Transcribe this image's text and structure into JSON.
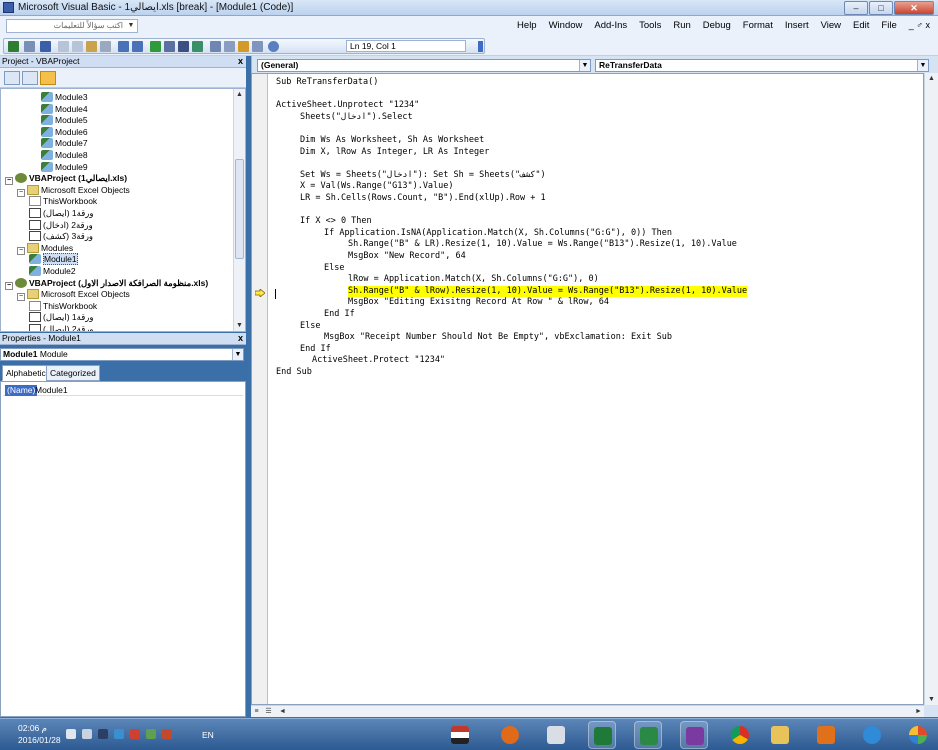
{
  "window": {
    "title": "Microsoft Visual Basic - 1ايصالي.xls [break] - [Module1 (Code)]",
    "controls": {
      "minimize": "–",
      "maximize": "□",
      "close": "✕"
    }
  },
  "menubar": {
    "ask_placeholder": "اكتب سؤالاً للتعليمات",
    "items": [
      "Help",
      "Window",
      "Add-Ins",
      "Tools",
      "Run",
      "Debug",
      "Format",
      "Insert",
      "View",
      "Edit",
      "File"
    ],
    "mdi_controls": "_ ♂ x"
  },
  "toolbar": {
    "position_readout": "Ln 19, Col 1",
    "icons": [
      "excel-icon",
      "insert-icon",
      "save-icon",
      "cut-icon",
      "copy-icon",
      "paste-icon",
      "find-icon",
      "undo-icon",
      "redo-icon",
      "run-icon",
      "break-icon",
      "reset-icon",
      "design-mode-icon",
      "project-explorer-icon",
      "properties-icon",
      "object-browser-icon",
      "toolbox-icon",
      "help-icon"
    ]
  },
  "project_pane": {
    "title": "Project - VBAProject",
    "close": "x",
    "tree": [
      {
        "label": "Module3",
        "icon": "module-icon",
        "indent": 3
      },
      {
        "label": "Module4",
        "icon": "module-icon",
        "indent": 3
      },
      {
        "label": "Module5",
        "icon": "module-icon",
        "indent": 3
      },
      {
        "label": "Module6",
        "icon": "module-icon",
        "indent": 3
      },
      {
        "label": "Module7",
        "icon": "module-icon",
        "indent": 3
      },
      {
        "label": "Module8",
        "icon": "module-icon",
        "indent": 3
      },
      {
        "label": "Module9",
        "icon": "module-icon",
        "indent": 3
      },
      {
        "label": "VBAProject (1ايصالي.xls)",
        "icon": "project-icon",
        "indent": 0,
        "bold": true,
        "expander": "−"
      },
      {
        "label": "Microsoft Excel Objects",
        "icon": "folder-icon",
        "indent": 1,
        "expander": "−"
      },
      {
        "label": "ThisWorkbook",
        "icon": "workbook-icon",
        "indent": 2
      },
      {
        "label": "(ورقة1 (ايصال",
        "icon": "sheet-icon",
        "indent": 2
      },
      {
        "label": "(ورقة2 (ادخال",
        "icon": "sheet-icon",
        "indent": 2
      },
      {
        "label": "(ورقة3 (كشف",
        "icon": "sheet-icon",
        "indent": 2
      },
      {
        "label": "Modules",
        "icon": "folder-icon",
        "indent": 1,
        "expander": "−"
      },
      {
        "label": "Module1",
        "icon": "module-icon",
        "indent": 2,
        "selected": true
      },
      {
        "label": "Module2",
        "icon": "module-icon",
        "indent": 2
      },
      {
        "label": "VBAProject (منظومة الصرافكة الاصدار الاول.xls)",
        "icon": "project-icon",
        "indent": 0,
        "bold": true,
        "expander": "−"
      },
      {
        "label": "Microsoft Excel Objects",
        "icon": "folder-icon",
        "indent": 1,
        "expander": "−"
      },
      {
        "label": "ThisWorkbook",
        "icon": "workbook-icon",
        "indent": 2
      },
      {
        "label": "(ورقة1 (ايصال",
        "icon": "sheet-icon",
        "indent": 2
      },
      {
        "label": "(ورقة2 (ايصال",
        "icon": "sheet-icon",
        "indent": 2
      }
    ]
  },
  "properties_pane": {
    "title": "Properties - Module1",
    "close": "x",
    "object_name": "Module1",
    "object_type": "Module",
    "tabs": [
      "Alphabetic",
      "Categorized"
    ],
    "rows": [
      {
        "name": "(Name)",
        "value": "Module1"
      }
    ]
  },
  "code_window": {
    "object_combo": "(General)",
    "proc_combo": "ReTransferData",
    "lines": [
      {
        "text": "Sub ReTransferData()",
        "indent": 0
      },
      {
        "text": "",
        "indent": 0
      },
      {
        "text": "ActiveSheet.Unprotect \"1234\"",
        "indent": 0
      },
      {
        "text": "Sheets(\"ادخال\").Select",
        "indent": 2
      },
      {
        "text": "",
        "indent": 0
      },
      {
        "text": "Dim Ws As Worksheet, Sh As Worksheet",
        "indent": 2
      },
      {
        "text": "Dim X, lRow As Integer, LR As Integer",
        "indent": 2
      },
      {
        "text": "",
        "indent": 0
      },
      {
        "text": "Set Ws = Sheets(\"ادخال\"): Set Sh = Sheets(\"كشف\")",
        "indent": 2
      },
      {
        "text": "X = Val(Ws.Range(\"G13\").Value)",
        "indent": 2
      },
      {
        "text": "LR = Sh.Cells(Rows.Count, \"B\").End(xlUp).Row + 1",
        "indent": 2
      },
      {
        "text": "",
        "indent": 0
      },
      {
        "text": "If X <> 0 Then",
        "indent": 2
      },
      {
        "text": "If Application.IsNA(Application.Match(X, Sh.Columns(\"G:G\"), 0)) Then",
        "indent": 4
      },
      {
        "text": "Sh.Range(\"B\" & LR).Resize(1, 10).Value = Ws.Range(\"B13\").Resize(1, 10).Value",
        "indent": 6
      },
      {
        "text": "MsgBox \"New Record\", 64",
        "indent": 6
      },
      {
        "text": "Else",
        "indent": 4
      },
      {
        "text": "lRow = Application.Match(X, Sh.Columns(\"G:G\"), 0)",
        "indent": 6
      },
      {
        "text": "Sh.Range(\"B\" & lRow).Resize(1, 10).Value = Ws.Range(\"B13\").Resize(1, 10).Value",
        "indent": 6,
        "highlight": true
      },
      {
        "text": "MsgBox \"Editing Exisitng Record At Row \" & lRow, 64",
        "indent": 6
      },
      {
        "text": "End If",
        "indent": 4
      },
      {
        "text": "Else",
        "indent": 2
      },
      {
        "text": "MsgBox \"Receipt Number Should Not Be Empty\", vbExclamation: Exit Sub",
        "indent": 4
      },
      {
        "text": "End If",
        "indent": 2
      },
      {
        "text": "ActiveSheet.Protect \"1234\"",
        "indent": 3
      },
      {
        "text": "End Sub",
        "indent": 0
      }
    ]
  },
  "taskbar": {
    "time": "02:06 م",
    "date": "2016/01/28",
    "language": "EN",
    "apps": [
      "flag-icon",
      "firefox-icon",
      "network-icon",
      "excel-icon",
      "excel-icon",
      "visual-basic-icon",
      "chrome-icon",
      "explorer-icon",
      "outlook-icon",
      "internet-explorer-icon",
      "start-button-icon"
    ],
    "colors": {
      "taskbar": "#2c5a92",
      "highlight": "#ffff00",
      "selection": "#3d6bc5"
    }
  }
}
